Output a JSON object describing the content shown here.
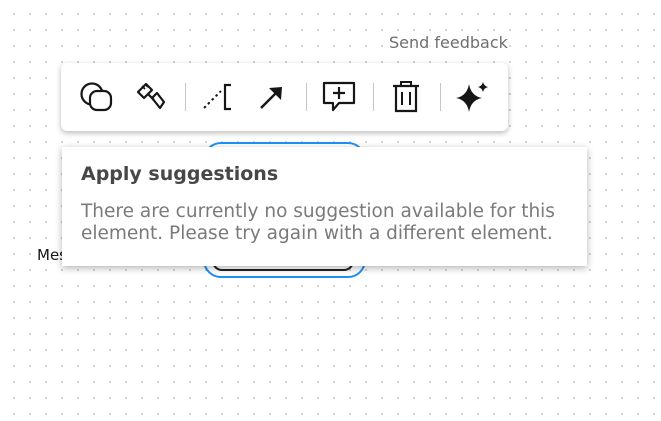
{
  "header": {
    "feedback_label": "Send feedback"
  },
  "canvas": {
    "node_label": "Mes"
  },
  "toolbar": {
    "tools": [
      {
        "name": "shapes",
        "icon": "shapes-icon"
      },
      {
        "name": "style",
        "icon": "paintbrush-icon"
      },
      {
        "name": "connector",
        "icon": "dotted-bracket-icon"
      },
      {
        "name": "arrow",
        "icon": "arrow-icon"
      },
      {
        "name": "comment",
        "icon": "add-comment-icon"
      },
      {
        "name": "delete",
        "icon": "trash-icon"
      },
      {
        "name": "ai-suggestions",
        "icon": "sparkle-icon"
      }
    ]
  },
  "tooltip": {
    "title": "Apply suggestions",
    "body": "There are currently no suggestion available for this element. Please try again with a different element."
  },
  "colors": {
    "selection": "#1e90f5",
    "tooltip_title": "#474747",
    "tooltip_body": "#7a7a7a"
  }
}
